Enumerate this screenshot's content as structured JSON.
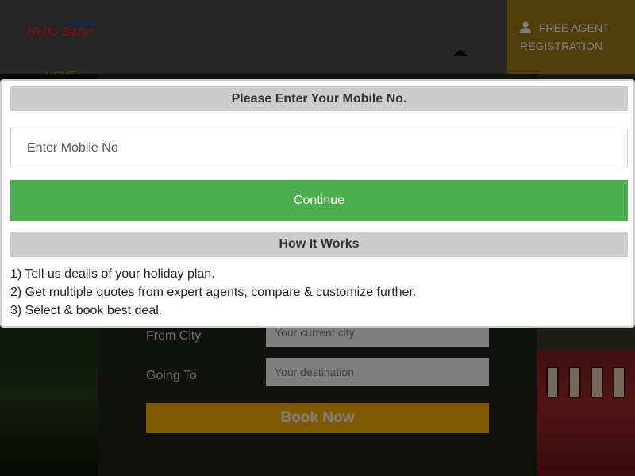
{
  "header": {
    "logo_text": "Hello Safar",
    "agent_button_label": "FREE AGENT REGISTRATION",
    "nav_home": "HOME"
  },
  "background_form": {
    "from_city_label": "From City",
    "from_city_placeholder": "Your current city",
    "going_to_label": "Going To",
    "going_to_placeholder": "Your destination",
    "book_now_label": "Book Now"
  },
  "modal": {
    "title": "Please Enter Your Mobile No.",
    "mobile_placeholder": "Enter Mobile No",
    "mobile_value": "",
    "continue_label": "Continue",
    "how_it_works_title": "How It Works",
    "steps": [
      "1) Tell us deails of your holiday plan.",
      "2) Get multiple quotes from expert agents, compare & customize further.",
      "3) Select & book best deal."
    ]
  },
  "colors": {
    "accent_gold": "#a07b18",
    "book_button": "#ffb400",
    "continue_green": "#4cae4c",
    "modal_header_gray": "#cccccc"
  }
}
